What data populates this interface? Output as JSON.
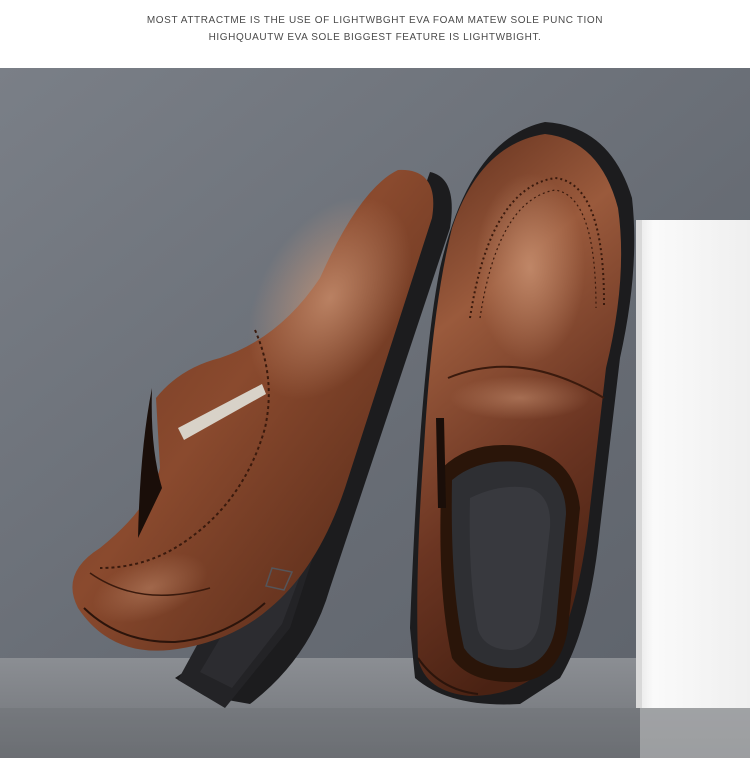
{
  "caption": {
    "line1": "MOST ATTRACTME IS THE USE OF LIGHTWBGHT EVA FOAM MATEW SOLE PUNC TION",
    "line2": "HIGHQUAUTW EVA SOLE BIGGEST FEATURE IS LIGHTWBIGHT."
  },
  "colors": {
    "background_wall": "#6e737b",
    "floor": "#7e8186",
    "leather": "#5a2b1a",
    "leather_highlight": "#9a5a3c",
    "sole": "#1c1c1e",
    "insole": "#2e2f33",
    "box": "#f1f1f1"
  },
  "objects": [
    "left-shoe",
    "right-shoe",
    "white-box"
  ]
}
